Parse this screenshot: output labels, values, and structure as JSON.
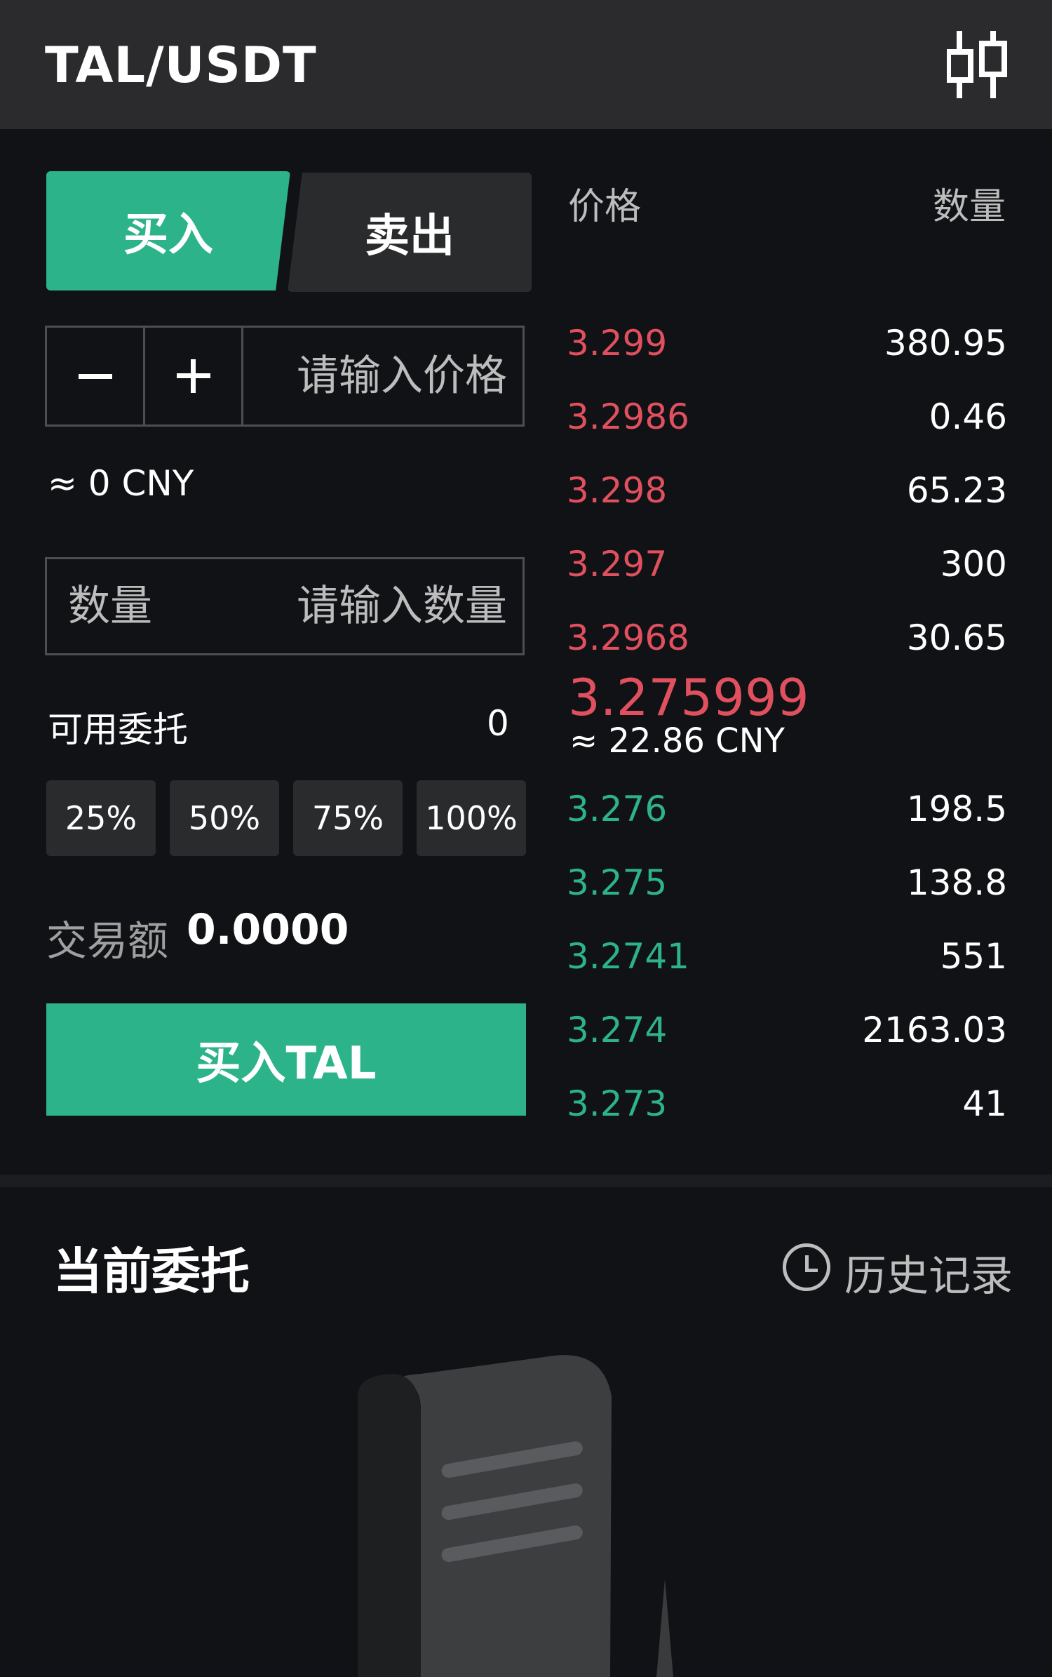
{
  "header": {
    "title": "TAL/USDT",
    "chart_icon": "candlestick-chart-icon"
  },
  "trade": {
    "tab_buy": "买入",
    "tab_sell": "卖出",
    "price_placeholder": "请输入价格",
    "approx_cny": "≈ 0 CNY",
    "qty_label": "数量",
    "qty_placeholder": "请输入数量",
    "available_label": "可用委托",
    "available_value": "0",
    "percent_options": [
      "25%",
      "50%",
      "75%",
      "100%"
    ],
    "amount_label": "交易额",
    "amount_value": "0.0000",
    "submit_label": "买入TAL"
  },
  "orderbook": {
    "price_header": "价格",
    "qty_header": "数量",
    "asks": [
      {
        "price": "3.299",
        "qty": "380.95"
      },
      {
        "price": "3.2986",
        "qty": "0.46"
      },
      {
        "price": "3.298",
        "qty": "65.23"
      },
      {
        "price": "3.297",
        "qty": "300"
      },
      {
        "price": "3.2968",
        "qty": "30.65"
      }
    ],
    "last_price": "3.275999",
    "last_price_cny": "≈ 22.86 CNY",
    "bids": [
      {
        "price": "3.276",
        "qty": "198.5"
      },
      {
        "price": "3.275",
        "qty": "138.8"
      },
      {
        "price": "3.2741",
        "qty": "551"
      },
      {
        "price": "3.274",
        "qty": "2163.03"
      },
      {
        "price": "3.273",
        "qty": "41"
      }
    ]
  },
  "orders": {
    "title": "当前委托",
    "history_label": "历史记录",
    "history_icon": "clock-icon",
    "empty_illustration": "empty-scroll-icon"
  },
  "colors": {
    "background": "#111215",
    "header_bg": "#2b2b2d",
    "buy_green": "#2db38a",
    "sell_red": "#e0505f"
  }
}
